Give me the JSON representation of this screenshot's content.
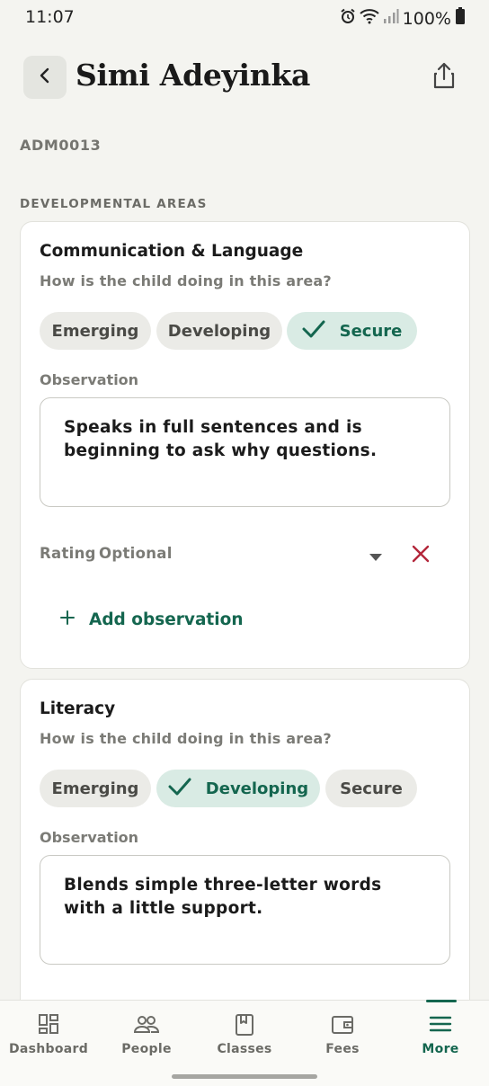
{
  "status_bar": {
    "time": "11:07",
    "battery": "100%"
  },
  "header": {
    "title": "Simi Adeyinka"
  },
  "child_id": "ADM0013",
  "section_label": "DEVELOPMENTAL AREAS",
  "areas": [
    {
      "title": "Communication & Language",
      "question": "How is the child doing in this area?",
      "options": [
        "Emerging",
        "Developing",
        "Secure"
      ],
      "selected": "Secure",
      "observation_label": "Observation",
      "observation": "Speaks in full sentences and is beginning to ask why questions.",
      "rating_label": "Rating",
      "rating_value": "Optional",
      "add_observation_label": "Add observation"
    },
    {
      "title": "Literacy",
      "question": "How is the child doing in this area?",
      "options": [
        "Emerging",
        "Developing",
        "Secure"
      ],
      "selected": "Developing",
      "observation_label": "Observation",
      "observation": "Blends simple three-letter words with a little support."
    }
  ],
  "bottom_nav": {
    "items": [
      {
        "label": "Dashboard",
        "icon": "dashboard-icon"
      },
      {
        "label": "People",
        "icon": "people-icon"
      },
      {
        "label": "Classes",
        "icon": "book-icon"
      },
      {
        "label": "Fees",
        "icon": "wallet-icon"
      },
      {
        "label": "More",
        "icon": "menu-icon"
      }
    ],
    "active": "More"
  },
  "colors": {
    "accent": "#14664f",
    "selected_chip_bg": "#d9ebe4",
    "remove_red": "#b3263a",
    "background": "#f4f4f0"
  }
}
